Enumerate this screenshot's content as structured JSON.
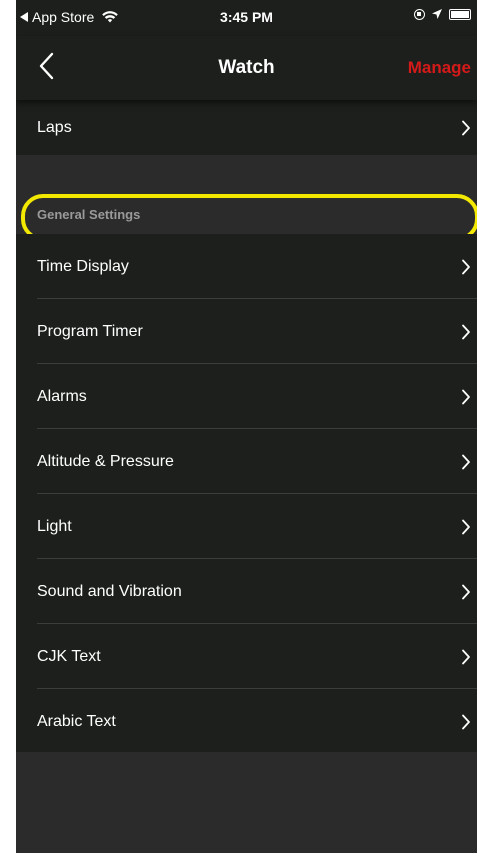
{
  "status_bar": {
    "back_app": "App Store",
    "time": "3:45 PM"
  },
  "nav": {
    "title": "Watch",
    "action": "Manage",
    "accent_color": "#d51a1a"
  },
  "top_item": {
    "label": "Laps"
  },
  "section": {
    "title": "General Settings",
    "highlight_color": "#f2e800"
  },
  "items": [
    {
      "label": "Time Display"
    },
    {
      "label": "Program Timer"
    },
    {
      "label": "Alarms"
    },
    {
      "label": "Altitude & Pressure"
    },
    {
      "label": "Light"
    },
    {
      "label": "Sound and Vibration"
    },
    {
      "label": "CJK Text"
    },
    {
      "label": "Arabic Text"
    }
  ]
}
